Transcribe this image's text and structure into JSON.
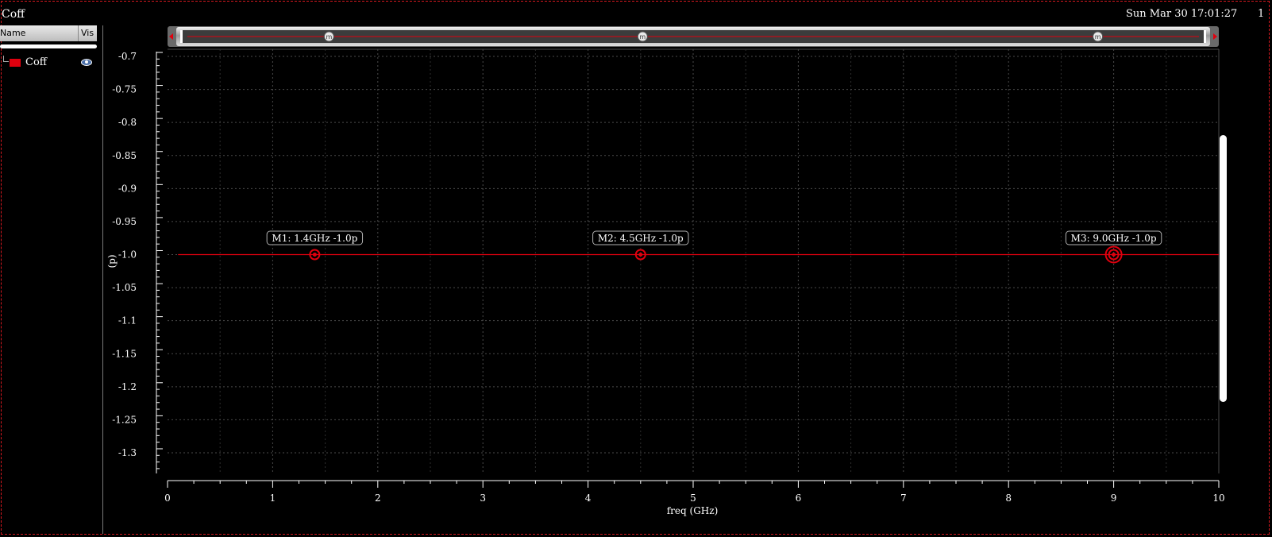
{
  "window": {
    "title": "Coff",
    "timestamp": "Sun Mar 30 17:01:27",
    "corner_mark": "1"
  },
  "legend": {
    "header_name": "Name",
    "header_vis": "Vis",
    "entries": [
      {
        "label": "Coff",
        "color": "#e0000e",
        "icon": "eye-icon"
      }
    ]
  },
  "colors": {
    "trace": "#e0000e",
    "background": "#000000",
    "grid": "#4a4a4a",
    "text": "#ffffff"
  },
  "chart_data": {
    "type": "line",
    "title": "",
    "xlabel": "freq (GHz)",
    "ylabel": "(p)",
    "xlim": [
      0,
      10
    ],
    "ylim": [
      -1.33,
      -0.69
    ],
    "x_ticks": [
      0,
      1,
      2,
      3,
      4,
      5,
      6,
      7,
      8,
      9,
      10
    ],
    "x_tick_labels": [
      "0",
      "1",
      "2",
      "3",
      "4",
      "5",
      "6",
      "7",
      "8",
      "9",
      "10"
    ],
    "y_ticks": [
      -0.7,
      -0.75,
      -0.8,
      -0.85,
      -0.9,
      -0.95,
      -1.0,
      -1.05,
      -1.1,
      -1.15,
      -1.2,
      -1.25,
      -1.3
    ],
    "y_tick_labels": [
      "-0.7",
      "-0.75",
      "-0.8",
      "-0.85",
      "-0.9",
      "-0.95",
      "-1.0",
      "-1.05",
      "-1.1",
      "-1.15",
      "-1.2",
      "-1.25",
      "-1.3"
    ],
    "grid": true,
    "series": [
      {
        "name": "Coff",
        "color": "#e0000e",
        "x": [
          0.1,
          10
        ],
        "y": [
          -1.0,
          -1.0
        ]
      }
    ],
    "markers": [
      {
        "label": "M1: 1.4GHz -1.0p",
        "x": 1.4,
        "y": -1.0
      },
      {
        "label": "M2: 4.5GHz -1.0p",
        "x": 4.5,
        "y": -1.0
      },
      {
        "label": "M3: 9.0GHz -1.0p",
        "x": 9.0,
        "y": -1.0,
        "selected": true
      }
    ]
  }
}
